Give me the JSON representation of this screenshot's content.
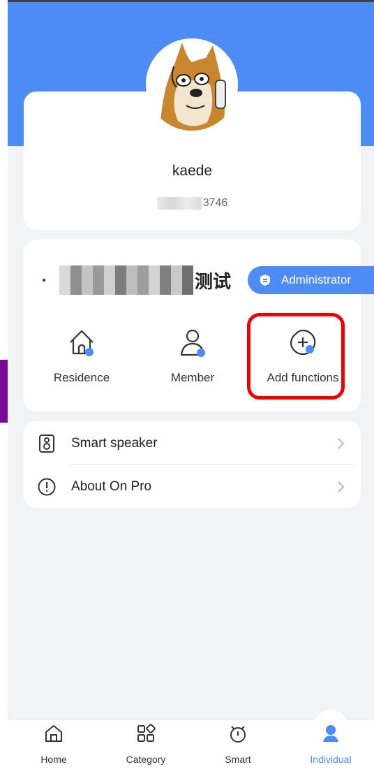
{
  "profile": {
    "username": "kaede",
    "phone_suffix": "3746"
  },
  "home": {
    "name_suffix": "测试",
    "role_badge": "Administrator"
  },
  "functions": [
    {
      "label": "Residence",
      "icon": "house-icon"
    },
    {
      "label": "Member",
      "icon": "person-icon"
    },
    {
      "label": "Add functions",
      "icon": "add-circle-icon"
    }
  ],
  "menu": [
    {
      "label": "Smart speaker",
      "icon": "speaker-icon"
    },
    {
      "label": "About On Pro",
      "icon": "info-exclamation-icon"
    }
  ],
  "tabs": [
    {
      "label": "Home",
      "icon": "home-icon"
    },
    {
      "label": "Category",
      "icon": "category-icon"
    },
    {
      "label": "Smart",
      "icon": "smart-icon"
    },
    {
      "label": "Individual",
      "icon": "individual-icon",
      "active": true
    }
  ],
  "colors": {
    "primary": "#4d8cf4",
    "highlight": "#ee0000",
    "background": "#f2f3f7"
  }
}
